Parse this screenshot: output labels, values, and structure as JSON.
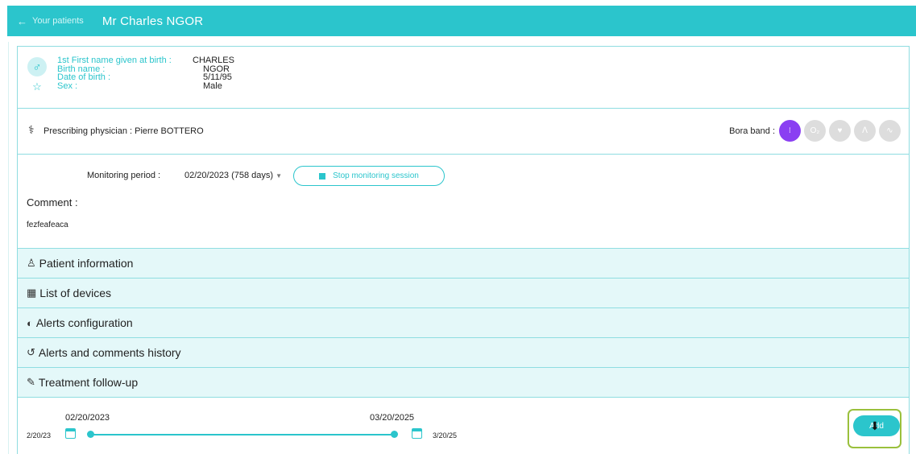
{
  "header": {
    "back_label": "Your patients",
    "patient_name": "Mr Charles NGOR"
  },
  "identity": {
    "sex_symbol": "♂",
    "labels": [
      "1st First name given at birth :",
      "Birth name :",
      "Date of birth :",
      "Sex :"
    ],
    "values": [
      "CHARLES",
      "NGOR",
      "5/11/95",
      "Male"
    ]
  },
  "physician": {
    "label": "Prescribing physician : Pierre BOTTERO",
    "bora_label": "Bora band :",
    "bora_icons": [
      {
        "name": "pill",
        "glyph": "⁝",
        "active": true
      },
      {
        "name": "oxygen",
        "glyph": "O₂",
        "active": false
      },
      {
        "name": "heart",
        "glyph": "♥",
        "active": false
      },
      {
        "name": "lungs",
        "glyph": "ᐱ",
        "active": false
      },
      {
        "name": "pulse",
        "glyph": "∿",
        "active": false
      }
    ]
  },
  "monitoring": {
    "label": "Monitoring period :",
    "value": "02/20/2023 (758 days)",
    "stop_button": "Stop monitoring session",
    "comment_label": "Comment :",
    "comment_text": "fezfeafeaca"
  },
  "sections": [
    {
      "label": "Patient information",
      "icon": "person-icon",
      "glyph": "♙"
    },
    {
      "label": "List of devices",
      "icon": "devices-icon",
      "glyph": "▦"
    },
    {
      "label": "Alerts configuration",
      "icon": "toggle-icon",
      "glyph": "◐"
    },
    {
      "label": "Alerts and comments history",
      "icon": "history-icon",
      "glyph": "↺"
    },
    {
      "label": "Treatment follow-up",
      "icon": "edit-note-icon",
      "glyph": "✎"
    }
  ],
  "timeline": {
    "start_date": "02/20/2023",
    "end_date": "03/20/2025",
    "start_short": "2/20/23",
    "end_short": "3/20/25",
    "add_label": "Add"
  }
}
